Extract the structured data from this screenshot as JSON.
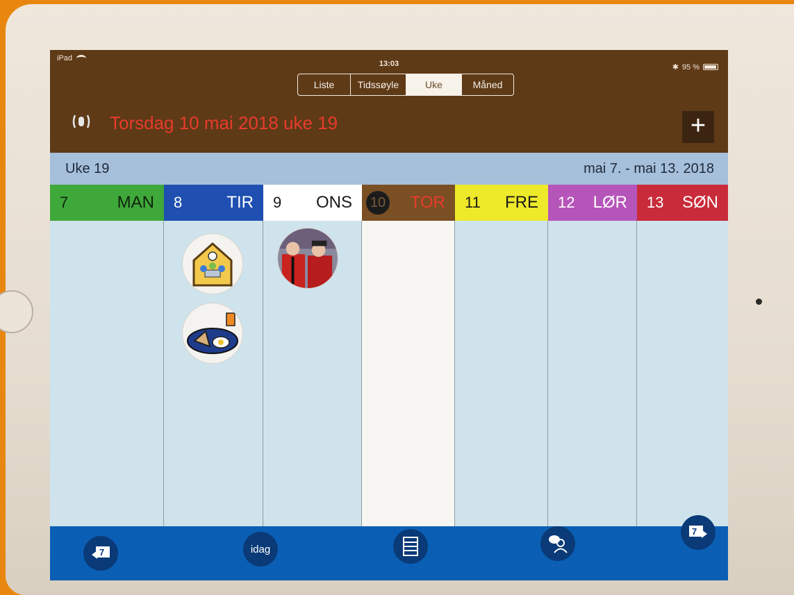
{
  "status_bar": {
    "device": "iPad",
    "time": "13:03",
    "battery": "95 %"
  },
  "view_tabs": [
    {
      "label": "Liste",
      "active": false
    },
    {
      "label": "Tidssøyle",
      "active": false
    },
    {
      "label": "Uke",
      "active": true
    },
    {
      "label": "Måned",
      "active": false
    }
  ],
  "header": {
    "date_title": "Torsdag 10 mai 2018 uke 19",
    "add_label": "+"
  },
  "week": {
    "label": "Uke 19",
    "range": "mai 7. - mai 13. 2018"
  },
  "days": [
    {
      "num": "7",
      "name": "MAN",
      "color": "#3fa83a",
      "text_color": "#10240d"
    },
    {
      "num": "8",
      "name": "TIR",
      "color": "#1f4fb0",
      "text_color": "#ffffff"
    },
    {
      "num": "9",
      "name": "ONS",
      "color": "#ffffff",
      "text_color": "#1a1a1a"
    },
    {
      "num": "10",
      "name": "TOR",
      "color": "#7a4f24",
      "text_color": "#e83b2c"
    },
    {
      "num": "11",
      "name": "FRE",
      "color": "#eeea2a",
      "text_color": "#1a1a1a"
    },
    {
      "num": "12",
      "name": "LØR",
      "color": "#b655b9",
      "text_color": "#ffffff"
    },
    {
      "num": "13",
      "name": "SØN",
      "color": "#c92b3a",
      "text_color": "#ffffff"
    }
  ],
  "activities": [
    {
      "day": "TIR",
      "icon": "meeting-icon"
    },
    {
      "day": "TIR",
      "icon": "breakfast-icon"
    },
    {
      "day": "ONS",
      "icon": "photo-icon"
    }
  ],
  "toolbar": {
    "prev_week_label": "7",
    "today_label": "idag",
    "next_week_label": "7",
    "colors": {
      "bar": "#0a5fb4",
      "button": "#0a3a78"
    }
  }
}
